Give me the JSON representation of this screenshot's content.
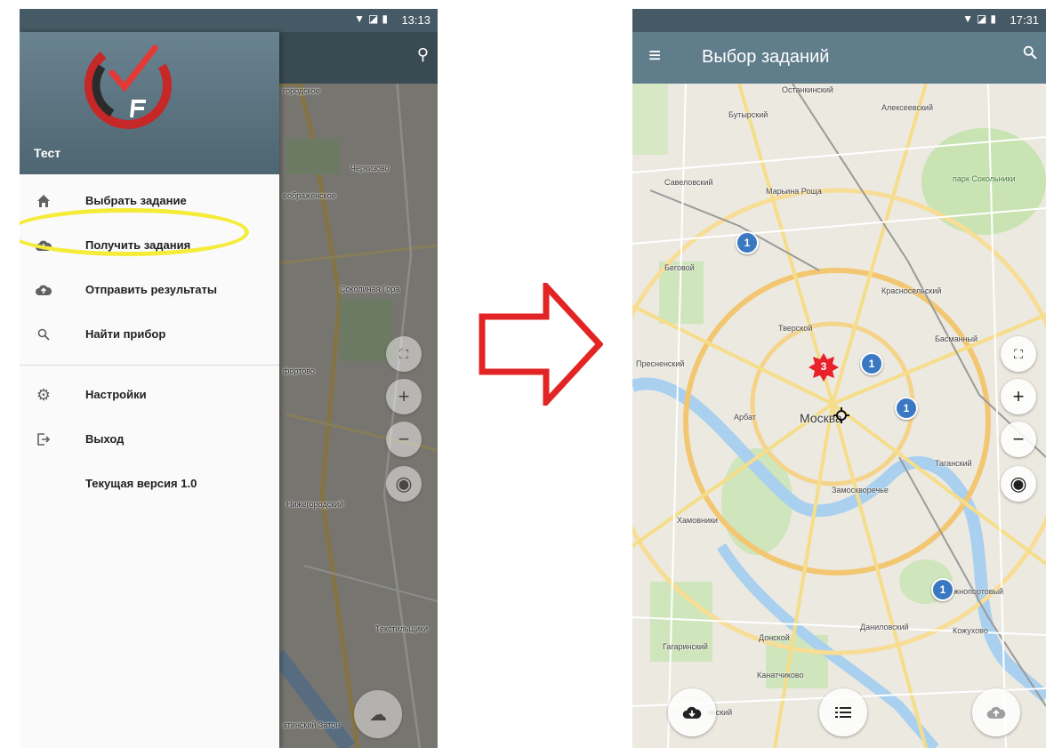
{
  "left_screen": {
    "status_time": "13:13",
    "drawer": {
      "user_name": "Тест",
      "items": [
        {
          "label": "Выбрать задание",
          "icon": "home-icon"
        },
        {
          "label": "Получить задания",
          "icon": "cloud-download-icon"
        },
        {
          "label": "Отправить результаты",
          "icon": "cloud-upload-icon"
        },
        {
          "label": "Найти прибор",
          "icon": "search-icon"
        },
        {
          "label": "Настройки",
          "icon": "gear-icon"
        },
        {
          "label": "Выход",
          "icon": "exit-icon"
        },
        {
          "label": "Текущая версия 1.0",
          "icon": ""
        }
      ]
    },
    "map_labels": [
      "городское",
      "Черкизово",
      "еображенское",
      "Соколиная Гора",
      "фортово",
      "Нижегородский",
      "Текстильщики",
      "атинский Затон"
    ]
  },
  "right_screen": {
    "status_time": "17:31",
    "title": "Выбор заданий",
    "map_labels": {
      "ostankinsky": "Останкинский",
      "alekseevsky": "Алексеевский",
      "butyrsky": "Бутырский",
      "savelovsky": "Савеловский",
      "maryina_roshcha": "Марьина Роща",
      "sokolniki": "парк Сокольники",
      "begovoy": "Беговой",
      "krasnoselsky": "Красносельский",
      "tverskoy": "Тверской",
      "basmanny": "Басманный",
      "presnensky": "Пресненский",
      "arbat": "Арбат",
      "moscow": "Москва",
      "tagansky": "Таганский",
      "zamoskvorechye": "Замоскворечье",
      "khamovniki": "Хамовники",
      "yuzhnoportovy": "Южнопортовый",
      "danilovsky": "Даниловский",
      "kozhukhovo": "Кожухово",
      "donskoy": "Донской",
      "gagarinsky": "Гагаринский",
      "kanatchikovo": "Канатчиково",
      "lomonosovsky": "ческий"
    },
    "markers": [
      "1",
      "1",
      "1",
      "1"
    ],
    "cluster_marker": "3"
  }
}
